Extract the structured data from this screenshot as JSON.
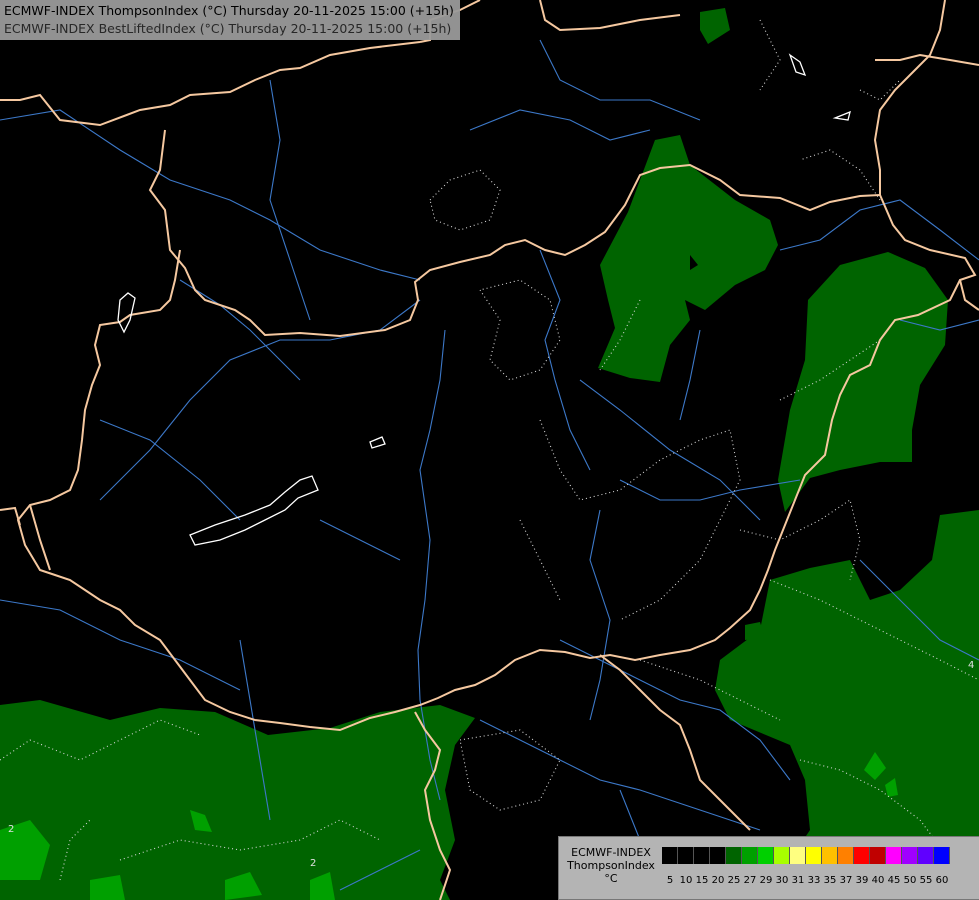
{
  "header": {
    "line1": "ECMWF-INDEX ThompsonIndex (°C) Thursday 20-11-2025 15:00 (+15h)",
    "line2": "ECMWF-INDEX BestLiftedIndex (°C) Thursday 20-11-2025 15:00 (+15h)"
  },
  "legend": {
    "title_line1": "ECMWF-INDEX",
    "title_line2": "ThompsonIndex",
    "title_line3": "°C",
    "stops": [
      "5",
      "10",
      "15",
      "20",
      "25",
      "27",
      "29",
      "30",
      "31",
      "33",
      "35",
      "37",
      "39",
      "40",
      "45",
      "50",
      "55",
      "60"
    ],
    "colors": [
      "#000000",
      "#000000",
      "#000000",
      "#000000",
      "#006400",
      "#00a000",
      "#00d000",
      "#a8ff00",
      "#ffff80",
      "#ffff00",
      "#ffc000",
      "#ff8000",
      "#ff0000",
      "#c00000",
      "#ff00ff",
      "#a000ff",
      "#6000ff",
      "#0000ff"
    ]
  },
  "map_labels": {
    "contour_sw": "2",
    "contour_s": "2",
    "contour_e": "4"
  },
  "colors": {
    "background": "#000000",
    "border": "#f5c8a0",
    "river": "#3c78c8",
    "ti_fill_dark": "#006400",
    "ti_fill_mid": "#00a000"
  }
}
